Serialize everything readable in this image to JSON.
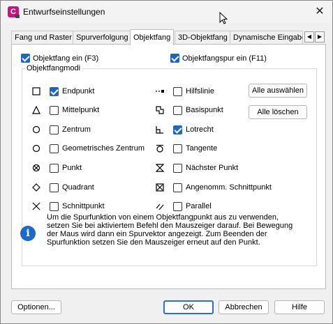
{
  "window": {
    "title": "Entwurfseinstellungen",
    "app_icon_text": "C"
  },
  "tabs": [
    {
      "label": "Fang und Raster",
      "active": false
    },
    {
      "label": "Spurverfolgung",
      "active": false
    },
    {
      "label": "Objektfang",
      "active": true
    },
    {
      "label": "3D-Objektfang",
      "active": false
    },
    {
      "label": "Dynamische Eingabe",
      "active": false
    }
  ],
  "top_checks": {
    "osnap_on": {
      "label": "Objektfang ein (F3)",
      "checked": true
    },
    "tracking_on": {
      "label": "Objektfangspur ein (F11)",
      "checked": true
    }
  },
  "group": {
    "legend": "Objektfangmodi",
    "left_modes": [
      {
        "label": "Endpunkt",
        "checked": true,
        "icon": "endpoint-square-icon"
      },
      {
        "label": "Mittelpunkt",
        "checked": false,
        "icon": "midpoint-triangle-icon"
      },
      {
        "label": "Zentrum",
        "checked": false,
        "icon": "center-circle-icon"
      },
      {
        "label": "Geometrisches Zentrum",
        "checked": false,
        "icon": "geometric-center-icon"
      },
      {
        "label": "Punkt",
        "checked": false,
        "icon": "node-icon"
      },
      {
        "label": "Quadrant",
        "checked": false,
        "icon": "quadrant-diamond-icon"
      },
      {
        "label": "Schnittpunkt",
        "checked": false,
        "icon": "intersection-x-icon"
      }
    ],
    "right_modes": [
      {
        "label": "Hilfslinie",
        "checked": false,
        "icon": "extension-icon"
      },
      {
        "label": "Basispunkt",
        "checked": false,
        "icon": "insertion-icon"
      },
      {
        "label": "Lotrecht",
        "checked": true,
        "icon": "perpendicular-icon"
      },
      {
        "label": "Tangente",
        "checked": false,
        "icon": "tangent-icon"
      },
      {
        "label": "Nächster Punkt",
        "checked": false,
        "icon": "nearest-hourglass-icon"
      },
      {
        "label": "Angenomm. Schnittpunkt",
        "checked": false,
        "icon": "apparent-intersection-icon"
      },
      {
        "label": "Parallel",
        "checked": false,
        "icon": "parallel-icon"
      }
    ],
    "select_all": "Alle auswählen",
    "clear_all": "Alle löschen",
    "info": "Um die Spurfunktion von einem Objektfangpunkt aus zu verwenden, setzen Sie bei aktiviertem Befehl den Mauszeiger darauf. Bei Bewegung der Maus wird dann ein Spurvektor angezeigt. Zum Beenden der Spurfunktion setzen Sie den Mauszeiger erneut auf den Punkt."
  },
  "footer": {
    "options": "Optionen...",
    "ok": "OK",
    "cancel": "Abbrechen",
    "help": "Hilfe"
  },
  "colors": {
    "accent": "#1f66c1",
    "app_icon": "#c3177f"
  }
}
